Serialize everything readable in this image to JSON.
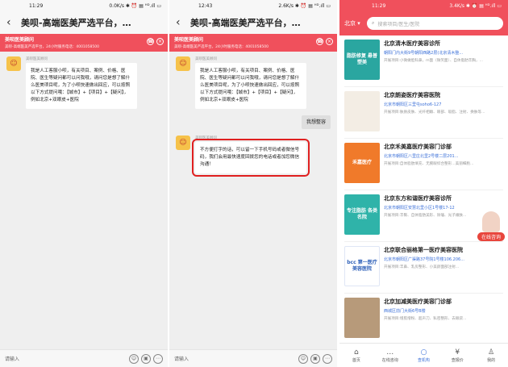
{
  "screen1": {
    "status_time": "11:29",
    "status_icons": "0.0K/s ✱ ⏰ ▤ ᴴᴰ.ıll ▭",
    "title": "美呗-高端医美严选平台，…",
    "banner": {
      "title": "美呗医美顾问",
      "subtitle": "美呗-高端医美严选平台，24小时服务电话：4001058500"
    },
    "messages": [
      {
        "sender": "美呗医美顾问",
        "text": "我是人工客服小呗，有关项目、案例、价格、医院、医生等疑问都可以问我哦，请问您是想了解什么医美项目呢，为了小呗快速做出回应，可以按照以下方式提问哦：【城市】+【项目】+【疑问】，例如北京+双眼皮+医院"
      }
    ],
    "input_placeholder": "请输入"
  },
  "screen2": {
    "status_time": "12:43",
    "status_icons": "2.6K/s ✱ ⏰ ▤ ᴴᴰ.ıll ▭",
    "title": "美呗-高端医美严选平台，…",
    "banner": {
      "title": "美呗医美顾问",
      "subtitle": "美呗-高端医美严选平台，24小时服务电话：4001058500"
    },
    "messages": [
      {
        "sender": "美呗医美顾问",
        "text": "我是人工客服小呗，有关项目、案例、价格、医院、医生等疑问都可以问我哦，请问您是想了解什么医美项目呢，为了小呗快速做出回应，可以按照以下方式提问哦：【城市】+【项目】+【疑问】，例如北京+双眼皮+医院"
      },
      {
        "sender": "",
        "text": "我想整容",
        "mine": true
      },
      {
        "sender": "美呗医美顾问",
        "text": "不方便打字的话，可以留一下手机号码或者微信号码，我们会用最快速度回拨您的电话或者加您微信沟通！"
      }
    ],
    "input_placeholder": "请输入"
  },
  "screen3": {
    "status_time": "11:29",
    "status_icons": "3.4K/s ✱ ⏰ ▤ ᴴᴰ.ıll ▭",
    "city": "北京",
    "search_placeholder": "搜索项目/医生/医院",
    "consult_label": "在线咨询",
    "thumb_labels": [
      "脂肪修复 悬普塑美",
      "",
      "禾嘉医疗",
      "专注脂肪 各类名院",
      "bcc 第一医疗 美容医院",
      ""
    ],
    "items": [
      {
        "name": "北京清木医疗美容诊所",
        "addr": "朝阳门内大街9号朝阳西路2层(北京清木整...",
        "desc": "开展项目:小微做脸科鼻，m面（微笑面）、自体脂肪丰胸，..."
      },
      {
        "name": "北京朗姿医疗美容医院",
        "addr": "北京市朝阳区三里屯soho6-127",
        "desc": "开展项目:肤质皮肤、光纤相嫩、眼部、吸脂、注射、换肤等..."
      },
      {
        "name": "北京禾美嘉医疗美容门诊部",
        "addr": "北京市朝阳区八里庄北里2号楼二层201...",
        "desc": "开展项目:自体脂肪填充、无腕眼综合整形...美丽细胞..."
      },
      {
        "name": "北京东方和谐医疗美容诊所",
        "addr": "北京市朝阳区安慧北里小区1号楼17-12",
        "desc": "开展项目:丰臀、自体脂肪美形、除皱、光子嫩肤..."
      },
      {
        "name": "北京联合丽格第一医疗美容医院",
        "addr": "北京市朝阳区广渠路37号院1号楼106.206...",
        "desc": "开展项目:丰鼻、乳房整形、小美颜面部注射..."
      },
      {
        "name": "北京加减美医疗美容门诊部",
        "addr": "西城区前门大街6号B楼",
        "desc": "开展项目:增肌增粉、超声刀、私密整形、去眼袋..."
      }
    ],
    "tabs": [
      {
        "label": "首页",
        "icon": "home-icon",
        "glyph": "⌂"
      },
      {
        "label": "在线咨询",
        "icon": "chat-icon",
        "glyph": "…"
      },
      {
        "label": "查机构",
        "icon": "search-icon",
        "glyph": "○"
      },
      {
        "label": "查报价",
        "icon": "price-icon",
        "glyph": "¥"
      },
      {
        "label": "我的",
        "icon": "user-icon",
        "glyph": "♙"
      }
    ]
  },
  "colors": {
    "brand_red": "#f0505c",
    "highlight_red": "#e02020",
    "link_blue": "#3a6fd8"
  }
}
